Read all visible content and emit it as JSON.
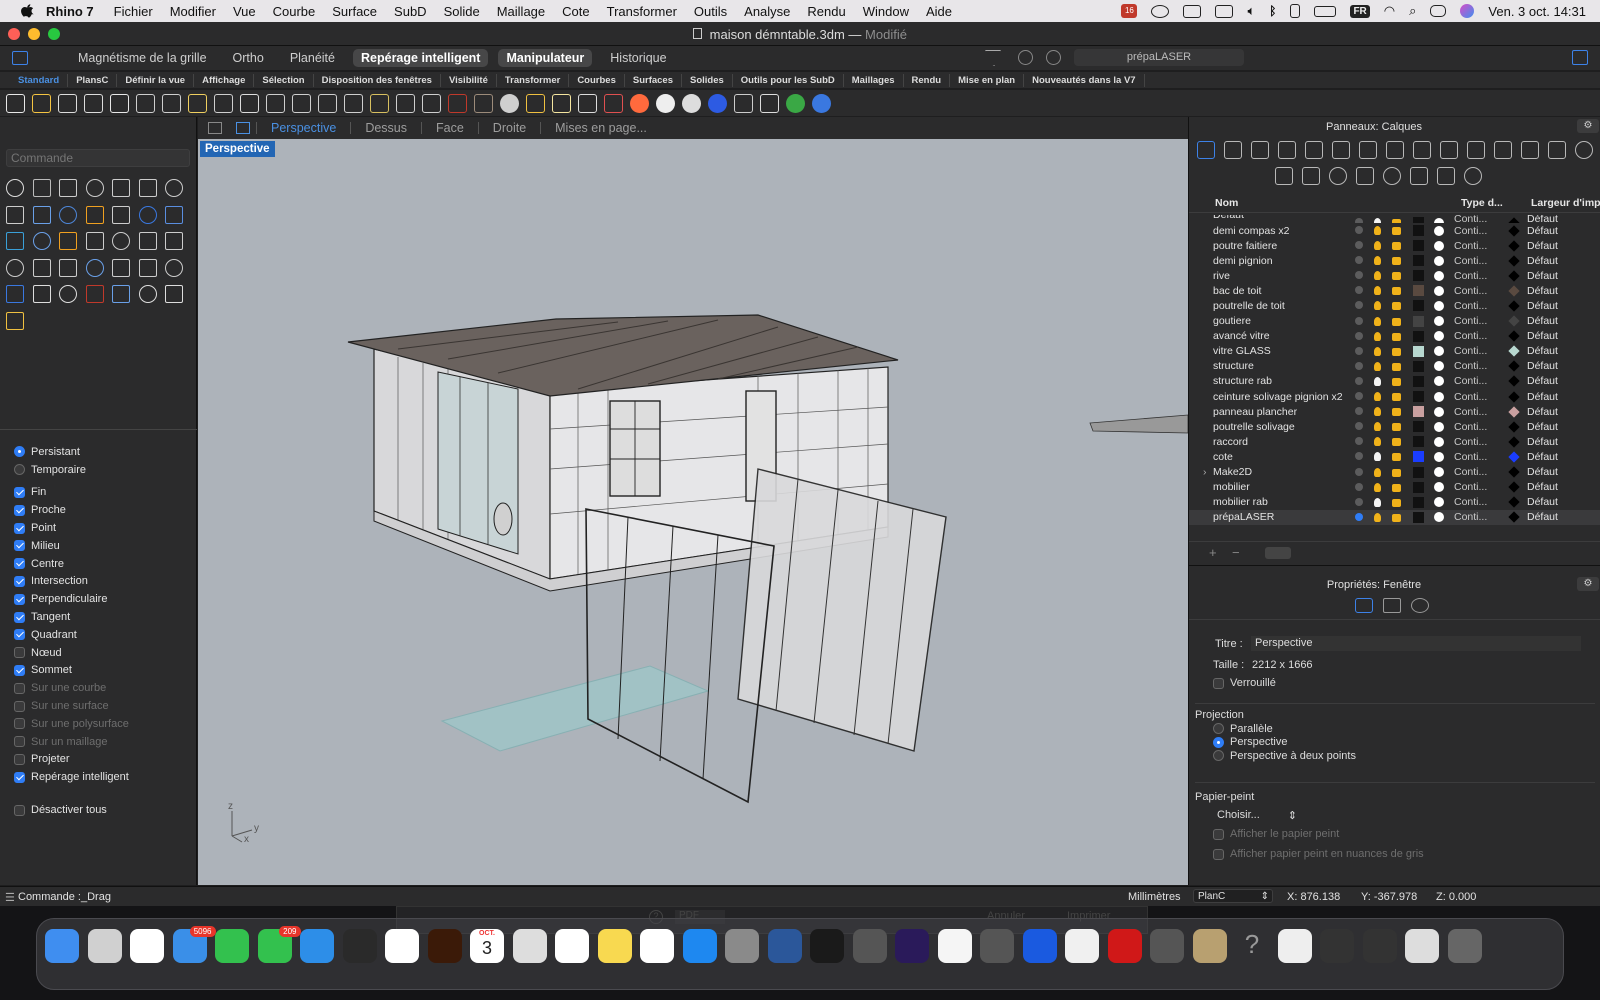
{
  "menubar": {
    "app_name": "Rhino 7",
    "items": [
      "Fichier",
      "Modifier",
      "Vue",
      "Courbe",
      "Surface",
      "SubD",
      "Solide",
      "Maillage",
      "Cote",
      "Transformer",
      "Outils",
      "Analyse",
      "Rendu",
      "Window",
      "Aide"
    ],
    "input_lang": "FR",
    "clock": "Ven. 3 oct.  14:31",
    "notification_badge": "16"
  },
  "window": {
    "title": "maison démntable.3dm",
    "separator": "—",
    "status": "Modifié"
  },
  "modebar": {
    "buttons": [
      {
        "label": "Magnétisme de la grille",
        "active": false
      },
      {
        "label": "Ortho",
        "active": false
      },
      {
        "label": "Planéité",
        "active": false
      },
      {
        "label": "Repérage intelligent",
        "active": true
      },
      {
        "label": "Manipulateur",
        "active": true
      },
      {
        "label": "Historique",
        "active": false
      }
    ],
    "layer_field": "prépaLASER"
  },
  "tabs": [
    "Standard",
    "PlansC",
    "Définir la vue",
    "Affichage",
    "Sélection",
    "Disposition des fenêtres",
    "Visibilité",
    "Transformer",
    "Courbes",
    "Surfaces",
    "Solides",
    "Outils pour les SubD",
    "Maillages",
    "Rendu",
    "Mise en plan",
    "Nouveautés dans la V7"
  ],
  "active_tab": "Standard",
  "toolbar_icons": [
    "new-file-icon",
    "open-folder-icon",
    "save-icon",
    "print-icon",
    "copy-file-icon",
    "cut-icon",
    "copy-icon",
    "paste-icon",
    "undo-icon",
    "pan-hand-icon",
    "move-icon",
    "zoom-icon",
    "zoom-window-icon",
    "zoom-extents-icon",
    "zoom-selected-icon",
    "rotate-view-icon",
    "viewport-layout-icon",
    "car-icon",
    "plane-icon",
    "target-icon",
    "gumball-icon",
    "light-bulb-icon",
    "lock-icon",
    "layer-icon",
    "color-wheel-icon",
    "sphere-shade-icon",
    "render-sphere-icon",
    "blue-sphere-icon",
    "rendered-icon",
    "grid-snap-icon",
    "globe-icon",
    "help-icon"
  ],
  "command": {
    "placeholder": "Commande"
  },
  "snaps": {
    "mode": [
      {
        "label": "Persistant",
        "on": true
      },
      {
        "label": "Temporaire",
        "on": false
      }
    ],
    "items": [
      {
        "label": "Fin",
        "on": true,
        "enabled": true
      },
      {
        "label": "Proche",
        "on": true,
        "enabled": true
      },
      {
        "label": "Point",
        "on": true,
        "enabled": true
      },
      {
        "label": "Milieu",
        "on": true,
        "enabled": true
      },
      {
        "label": "Centre",
        "on": true,
        "enabled": true
      },
      {
        "label": "Intersection",
        "on": true,
        "enabled": true
      },
      {
        "label": "Perpendiculaire",
        "on": true,
        "enabled": true
      },
      {
        "label": "Tangent",
        "on": true,
        "enabled": true
      },
      {
        "label": "Quadrant",
        "on": true,
        "enabled": true
      },
      {
        "label": "Nœud",
        "on": false,
        "enabled": true
      },
      {
        "label": "Sommet",
        "on": true,
        "enabled": true
      },
      {
        "label": "Sur une courbe",
        "on": false,
        "enabled": false
      },
      {
        "label": "Sur une surface",
        "on": false,
        "enabled": false
      },
      {
        "label": "Sur une polysurface",
        "on": false,
        "enabled": false
      },
      {
        "label": "Sur un maillage",
        "on": false,
        "enabled": false
      },
      {
        "label": "Projeter",
        "on": false,
        "enabled": true
      },
      {
        "label": "Repérage intelligent",
        "on": true,
        "enabled": true
      }
    ],
    "disable_all": "Désactiver tous"
  },
  "viewport": {
    "tabs": [
      "Perspective",
      "Dessus",
      "Face",
      "Droite",
      "Mises en page..."
    ],
    "active": "Perspective",
    "label": "Perspective",
    "axes": {
      "z": "z",
      "y": "y",
      "x": "x"
    }
  },
  "layers_panel": {
    "title": "Panneaux: Calques",
    "headers": {
      "name": "Nom",
      "type": "Type d...",
      "width": "Largeur d'impr"
    },
    "rows": [
      {
        "name": "Défaut",
        "bulb": "off",
        "color": "#111111"
      },
      {
        "name": "demi compas x2",
        "bulb": "on",
        "color": "#111111"
      },
      {
        "name": "poutre faitiere",
        "bulb": "on",
        "color": "#111111"
      },
      {
        "name": "demi pignion",
        "bulb": "on",
        "color": "#111111"
      },
      {
        "name": "rive",
        "bulb": "on",
        "color": "#111111"
      },
      {
        "name": "bac de toit",
        "bulb": "on",
        "color": "#5a4a40"
      },
      {
        "name": "poutrelle de toit",
        "bulb": "on",
        "color": "#111111"
      },
      {
        "name": "goutiere",
        "bulb": "on",
        "color": "#444444"
      },
      {
        "name": "avancé vitre",
        "bulb": "on",
        "color": "#111111"
      },
      {
        "name": "vitre GLASS",
        "bulb": "on",
        "color": "#b8d8d0"
      },
      {
        "name": "structure",
        "bulb": "on",
        "color": "#111111"
      },
      {
        "name": "structure rab",
        "bulb": "off",
        "color": "#111111"
      },
      {
        "name": "ceinture solivage pignion x2",
        "bulb": "on",
        "color": "#111111"
      },
      {
        "name": "panneau plancher",
        "bulb": "on",
        "color": "#c9a0a0"
      },
      {
        "name": "poutrelle solivage",
        "bulb": "on",
        "color": "#111111"
      },
      {
        "name": "raccord",
        "bulb": "on",
        "color": "#111111"
      },
      {
        "name": "cote",
        "bulb": "off",
        "color": "#1a3dff"
      },
      {
        "name": "Make2D",
        "bulb": "on",
        "color": "#111111",
        "expandable": true
      },
      {
        "name": "mobilier",
        "bulb": "on",
        "color": "#111111"
      },
      {
        "name": "mobilier rab",
        "bulb": "off",
        "color": "#111111"
      },
      {
        "name": "prépaLASER",
        "bulb": "on",
        "color": "#111111",
        "current": true
      }
    ],
    "linetype": "Conti...",
    "print_width": "Défaut"
  },
  "props_panel": {
    "title": "Propriétés: Fenêtre",
    "titre_label": "Titre :",
    "titre_value": "Perspective",
    "taille_label": "Taille :",
    "taille_value": "2212 x 1666",
    "locked_label": "Verrouillé",
    "projection_label": "Projection",
    "projection_options": [
      {
        "label": "Parallèle",
        "on": false
      },
      {
        "label": "Perspective",
        "on": true
      },
      {
        "label": "Perspective à deux points",
        "on": false
      }
    ],
    "wallpaper_label": "Papier-peint",
    "wallpaper_choose": "Choisir...",
    "wallpaper_show": "Afficher le papier peint",
    "wallpaper_gray": "Afficher papier peint en nuances de gris"
  },
  "status": {
    "command": "Commande :_Drag",
    "units": "Millimètres",
    "cplane": "PlanC",
    "x": "X: 876.138",
    "y": "Y: -367.978",
    "z": "Z: 0.000"
  },
  "background_dialog": {
    "pdf": "PDF",
    "cancel": "Annuler",
    "print": "Imprimer"
  },
  "dock": {
    "apps": [
      "finder",
      "launchpad",
      "chrome",
      "mail",
      "facetime",
      "messages",
      "safari",
      "spotify",
      "photos",
      "illustrator",
      "calendar",
      "screenshot",
      "reminders",
      "notes",
      "freeform",
      "app-store",
      "system-settings",
      "word",
      "quicktime",
      "direct-mail",
      "premiere",
      "clock",
      "rhino",
      "cloud-app",
      "textedit",
      "acrobat",
      "calculator",
      "preview",
      "help",
      "preview-thumbnail",
      "thumbnail-2",
      "thumbnail-3",
      "thumbnail-4",
      "trash"
    ],
    "mail_badge": "5096",
    "messages_badge": "209",
    "calendar_month": "OCT.",
    "calendar_day": "3"
  },
  "colors": {
    "accent": "#2f7df6",
    "tab_active": "#4a90e2",
    "viewport_bg": "#adb3ba",
    "panel_bg": "#2b2b2c"
  }
}
